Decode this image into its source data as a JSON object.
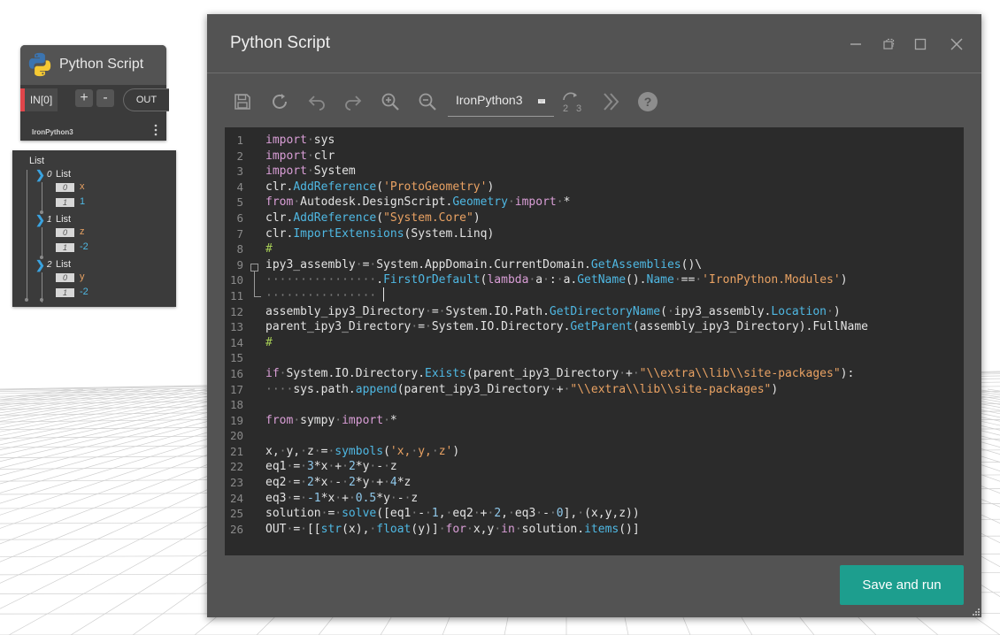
{
  "node": {
    "title": "Python Script",
    "input_port": "IN[0]",
    "add_label": "+",
    "remove_label": "-",
    "output_port": "OUT",
    "engine": "IronPython3"
  },
  "preview": {
    "root": "List",
    "groups": [
      {
        "index": "0",
        "label": "List",
        "items": [
          {
            "index": "0",
            "value": "x",
            "color": "#e9a263"
          },
          {
            "index": "1",
            "value": "1",
            "color": "#4fb8e3"
          }
        ]
      },
      {
        "index": "1",
        "label": "List",
        "items": [
          {
            "index": "0",
            "value": "z",
            "color": "#e9a263"
          },
          {
            "index": "1",
            "value": "-2",
            "color": "#4fb8e3"
          }
        ]
      },
      {
        "index": "2",
        "label": "List",
        "items": [
          {
            "index": "0",
            "value": "y",
            "color": "#e9a263"
          },
          {
            "index": "1",
            "value": "-2",
            "color": "#4fb8e3"
          }
        ]
      }
    ]
  },
  "window": {
    "title": "Python Script",
    "engine_label": "IronPython3",
    "save_run_label": "Save and run",
    "toolbar_icons": [
      "save-icon",
      "reload-icon",
      "undo-icon",
      "redo-icon",
      "zoom-in-icon",
      "zoom-out-icon",
      "convert-tabs-to-spaces-icon",
      "more-icon",
      "help-icon"
    ],
    "title_icons": [
      "minimize-icon",
      "dock-icon",
      "maximize-icon",
      "close-icon"
    ]
  },
  "code": {
    "lines": [
      [
        [
          "kw",
          "import"
        ],
        [
          "ws",
          "·"
        ],
        [
          "t",
          "sys"
        ]
      ],
      [
        [
          "kw",
          "import"
        ],
        [
          "ws",
          "·"
        ],
        [
          "t",
          "clr"
        ]
      ],
      [
        [
          "kw",
          "import"
        ],
        [
          "ws",
          "·"
        ],
        [
          "t",
          "System"
        ]
      ],
      [
        [
          "t",
          "clr."
        ],
        [
          "fn",
          "AddReference"
        ],
        [
          "t",
          "("
        ],
        [
          "str",
          "'ProtoGeometry'"
        ],
        [
          "t",
          ")"
        ]
      ],
      [
        [
          "kw",
          "from"
        ],
        [
          "ws",
          "·"
        ],
        [
          "t",
          "Autodesk.DesignScript."
        ],
        [
          "fn",
          "Geometry"
        ],
        [
          "ws",
          "·"
        ],
        [
          "kw",
          "import"
        ],
        [
          "ws",
          "·"
        ],
        [
          "t",
          "*"
        ]
      ],
      [
        [
          "t",
          "clr."
        ],
        [
          "fn",
          "AddReference"
        ],
        [
          "t",
          "("
        ],
        [
          "str",
          "\"System.Core\""
        ],
        [
          "t",
          ")"
        ]
      ],
      [
        [
          "t",
          "clr."
        ],
        [
          "fn",
          "ImportExtensions"
        ],
        [
          "t",
          "(System.Linq)"
        ]
      ],
      [
        [
          "cm",
          "#"
        ]
      ],
      [
        [
          "t",
          "ipy3_assembly"
        ],
        [
          "ws",
          "·"
        ],
        [
          "t",
          "="
        ],
        [
          "ws",
          "·"
        ],
        [
          "t",
          "System.AppDomain.CurrentDomain."
        ],
        [
          "fn",
          "GetAssemblies"
        ],
        [
          "t",
          "()\\"
        ]
      ],
      [
        [
          "ws",
          "················"
        ],
        [
          "t",
          "."
        ],
        [
          "fn",
          "FirstOrDefault"
        ],
        [
          "t",
          "("
        ],
        [
          "kw",
          "lambda"
        ],
        [
          "ws",
          "·"
        ],
        [
          "t",
          "a"
        ],
        [
          "ws",
          "·"
        ],
        [
          "t",
          ":"
        ],
        [
          "ws",
          "·"
        ],
        [
          "t",
          "a."
        ],
        [
          "fn",
          "GetName"
        ],
        [
          "t",
          "()."
        ],
        [
          "fn",
          "Name"
        ],
        [
          "ws",
          "·"
        ],
        [
          "t",
          "=="
        ],
        [
          "ws",
          "·"
        ],
        [
          "str",
          "'IronPython.Modules'"
        ],
        [
          "t",
          ")"
        ]
      ],
      [
        [
          "ws",
          "················"
        ]
      ],
      [
        [
          "t",
          "assembly_ipy3_Directory"
        ],
        [
          "ws",
          "·"
        ],
        [
          "t",
          "="
        ],
        [
          "ws",
          "·"
        ],
        [
          "t",
          "System.IO.Path."
        ],
        [
          "fn",
          "GetDirectoryName"
        ],
        [
          "t",
          "("
        ],
        [
          "ws",
          "·"
        ],
        [
          "t",
          "ipy3_assembly."
        ],
        [
          "fn",
          "Location"
        ],
        [
          "ws",
          "·"
        ],
        [
          "t",
          ")"
        ]
      ],
      [
        [
          "t",
          "parent_ipy3_Directory"
        ],
        [
          "ws",
          "·"
        ],
        [
          "t",
          "="
        ],
        [
          "ws",
          "·"
        ],
        [
          "t",
          "System.IO.Directory."
        ],
        [
          "fn",
          "GetParent"
        ],
        [
          "t",
          "(assembly_ipy3_Directory).FullName"
        ]
      ],
      [
        [
          "cm",
          "#"
        ]
      ],
      [],
      [
        [
          "kw",
          "if"
        ],
        [
          "ws",
          "·"
        ],
        [
          "t",
          "System.IO.Directory."
        ],
        [
          "fn",
          "Exists"
        ],
        [
          "t",
          "(parent_ipy3_Directory"
        ],
        [
          "ws",
          "·"
        ],
        [
          "t",
          "+"
        ],
        [
          "ws",
          "·"
        ],
        [
          "str",
          "\"\\\\extra\\\\lib\\\\site-packages\""
        ],
        [
          "t",
          "):"
        ]
      ],
      [
        [
          "ws",
          "····"
        ],
        [
          "t",
          "sys.path."
        ],
        [
          "fn",
          "append"
        ],
        [
          "t",
          "(parent_ipy3_Directory"
        ],
        [
          "ws",
          "·"
        ],
        [
          "t",
          "+"
        ],
        [
          "ws",
          "·"
        ],
        [
          "str",
          "\"\\\\extra\\\\lib\\\\site-packages\""
        ],
        [
          "t",
          ")"
        ]
      ],
      [],
      [
        [
          "kw",
          "from"
        ],
        [
          "ws",
          "·"
        ],
        [
          "t",
          "sympy"
        ],
        [
          "ws",
          "·"
        ],
        [
          "kw",
          "import"
        ],
        [
          "ws",
          "·"
        ],
        [
          "t",
          "*"
        ]
      ],
      [],
      [
        [
          "t",
          "x,"
        ],
        [
          "ws",
          "·"
        ],
        [
          "t",
          "y,"
        ],
        [
          "ws",
          "·"
        ],
        [
          "t",
          "z"
        ],
        [
          "ws",
          "·"
        ],
        [
          "t",
          "="
        ],
        [
          "ws",
          "·"
        ],
        [
          "fn",
          "symbols"
        ],
        [
          "t",
          "("
        ],
        [
          "str",
          "'x,"
        ],
        [
          "ws",
          "·"
        ],
        [
          "str",
          "y,"
        ],
        [
          "ws",
          "·"
        ],
        [
          "str",
          "z'"
        ],
        [
          "t",
          ")"
        ]
      ],
      [
        [
          "t",
          "eq1"
        ],
        [
          "ws",
          "·"
        ],
        [
          "t",
          "="
        ],
        [
          "ws",
          "·"
        ],
        [
          "num",
          "3"
        ],
        [
          "t",
          "*x"
        ],
        [
          "ws",
          "·"
        ],
        [
          "t",
          "+"
        ],
        [
          "ws",
          "·"
        ],
        [
          "num",
          "2"
        ],
        [
          "t",
          "*y"
        ],
        [
          "ws",
          "·"
        ],
        [
          "t",
          "-"
        ],
        [
          "ws",
          "·"
        ],
        [
          "t",
          "z"
        ]
      ],
      [
        [
          "t",
          "eq2"
        ],
        [
          "ws",
          "·"
        ],
        [
          "t",
          "="
        ],
        [
          "ws",
          "·"
        ],
        [
          "num",
          "2"
        ],
        [
          "t",
          "*x"
        ],
        [
          "ws",
          "·"
        ],
        [
          "t",
          "-"
        ],
        [
          "ws",
          "·"
        ],
        [
          "num",
          "2"
        ],
        [
          "t",
          "*y"
        ],
        [
          "ws",
          "·"
        ],
        [
          "t",
          "+"
        ],
        [
          "ws",
          "·"
        ],
        [
          "num",
          "4"
        ],
        [
          "t",
          "*z"
        ]
      ],
      [
        [
          "t",
          "eq3"
        ],
        [
          "ws",
          "·"
        ],
        [
          "t",
          "="
        ],
        [
          "ws",
          "·"
        ],
        [
          "num",
          "-1"
        ],
        [
          "t",
          "*x"
        ],
        [
          "ws",
          "·"
        ],
        [
          "t",
          "+"
        ],
        [
          "ws",
          "·"
        ],
        [
          "num",
          "0.5"
        ],
        [
          "t",
          "*y"
        ],
        [
          "ws",
          "·"
        ],
        [
          "t",
          "-"
        ],
        [
          "ws",
          "·"
        ],
        [
          "t",
          "z"
        ]
      ],
      [
        [
          "t",
          "solution"
        ],
        [
          "ws",
          "·"
        ],
        [
          "t",
          "="
        ],
        [
          "ws",
          "·"
        ],
        [
          "fn",
          "solve"
        ],
        [
          "t",
          "([eq1"
        ],
        [
          "ws",
          "·"
        ],
        [
          "t",
          "-"
        ],
        [
          "ws",
          "·"
        ],
        [
          "num",
          "1"
        ],
        [
          "t",
          ","
        ],
        [
          "ws",
          "·"
        ],
        [
          "t",
          "eq2"
        ],
        [
          "ws",
          "·"
        ],
        [
          "t",
          "+"
        ],
        [
          "ws",
          "·"
        ],
        [
          "num",
          "2"
        ],
        [
          "t",
          ","
        ],
        [
          "ws",
          "·"
        ],
        [
          "t",
          "eq3"
        ],
        [
          "ws",
          "·"
        ],
        [
          "t",
          "-"
        ],
        [
          "ws",
          "·"
        ],
        [
          "num",
          "0"
        ],
        [
          "t",
          "],"
        ],
        [
          "ws",
          "·"
        ],
        [
          "t",
          "(x,y,z))"
        ]
      ],
      [
        [
          "t",
          "OUT"
        ],
        [
          "ws",
          "·"
        ],
        [
          "t",
          "="
        ],
        [
          "ws",
          "·"
        ],
        [
          "t",
          "[["
        ],
        [
          "fn",
          "str"
        ],
        [
          "t",
          "(x),"
        ],
        [
          "ws",
          "·"
        ],
        [
          "fn",
          "float"
        ],
        [
          "t",
          "(y)]"
        ],
        [
          "ws",
          "·"
        ],
        [
          "kw",
          "for"
        ],
        [
          "ws",
          "·"
        ],
        [
          "t",
          "x,y"
        ],
        [
          "ws",
          "·"
        ],
        [
          "kw",
          "in"
        ],
        [
          "ws",
          "·"
        ],
        [
          "t",
          "solution."
        ],
        [
          "fn",
          "items"
        ],
        [
          "t",
          "()]"
        ]
      ]
    ]
  }
}
